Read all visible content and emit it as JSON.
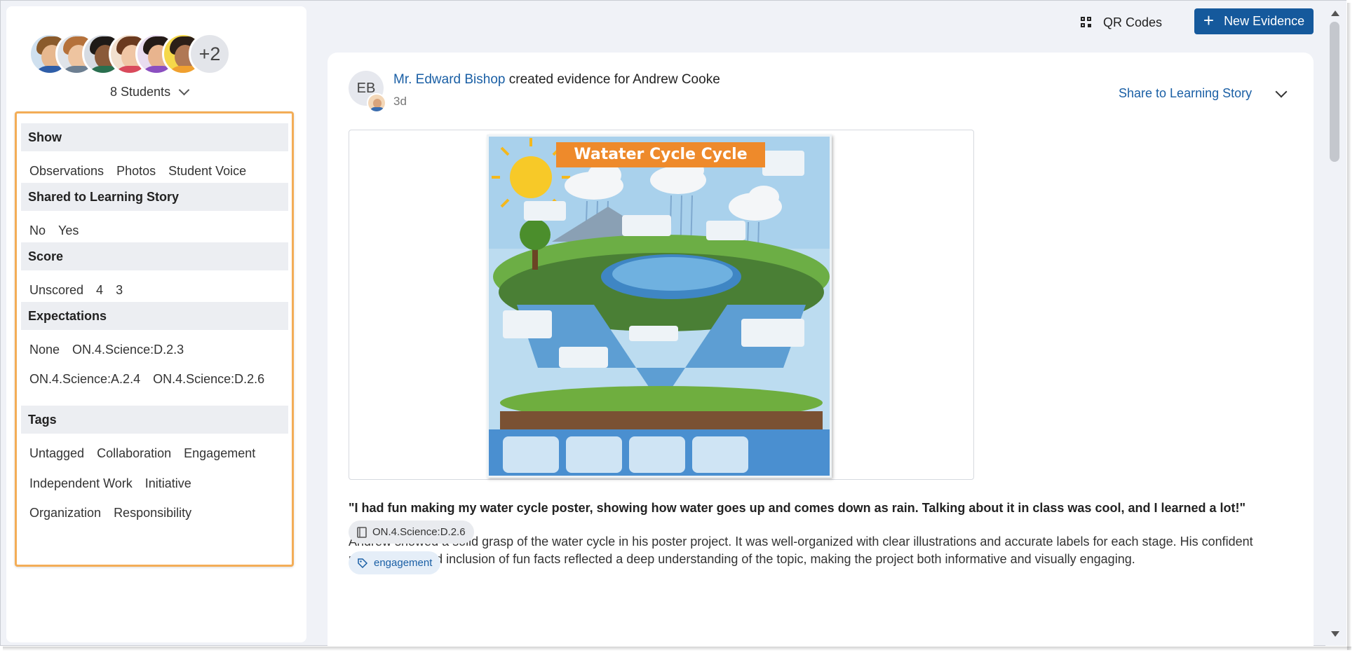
{
  "students": {
    "more_label": "+2",
    "count_label": "8 Students"
  },
  "filters": {
    "show": {
      "title": "Show",
      "options": [
        "Observations",
        "Photos",
        "Student Voice"
      ]
    },
    "shared": {
      "title": "Shared to Learning Story",
      "options": [
        "No",
        "Yes"
      ]
    },
    "score": {
      "title": "Score",
      "options": [
        "Unscored",
        "4",
        "3"
      ]
    },
    "expectations": {
      "title": "Expectations",
      "row1": [
        "None",
        "ON.4.Science:D.2.3"
      ],
      "row2": [
        "ON.4.Science:A.2.4",
        "ON.4.Science:D.2.6"
      ]
    },
    "tags": {
      "title": "Tags",
      "row1": [
        "Untagged",
        "Collaboration",
        "Engagement"
      ],
      "row2": [
        "Independent Work",
        "Initiative"
      ],
      "row3": [
        "Organization",
        "Responsibility"
      ]
    }
  },
  "toolbar": {
    "qr_label": "QR Codes",
    "new_label": "New Evidence",
    "accent": "#15599c"
  },
  "evidence": {
    "author_initials": "EB",
    "author_name": "Mr. Edward Bishop",
    "action_text": " created evidence for Andrew Cooke",
    "time_ago": "3d",
    "share_label": "Share to Learning Story",
    "poster_title": "Watater Cycle Cycle",
    "quote": "\"I had fun making my water cycle poster, showing how water goes up and comes down as rain. Talking about it in class was cool, and I learned a lot!\"",
    "description": "Andrew showed a solid grasp of the water cycle in his poster project. It was well-organized with clear illustrations and accurate labels for each stage. His confident presentation and inclusion of fun facts reflected a deep understanding of the topic, making the project both informative and visually engaging.",
    "expectation_chip": "ON.4.Science:D.2.6",
    "tag_chip": "engagement"
  }
}
